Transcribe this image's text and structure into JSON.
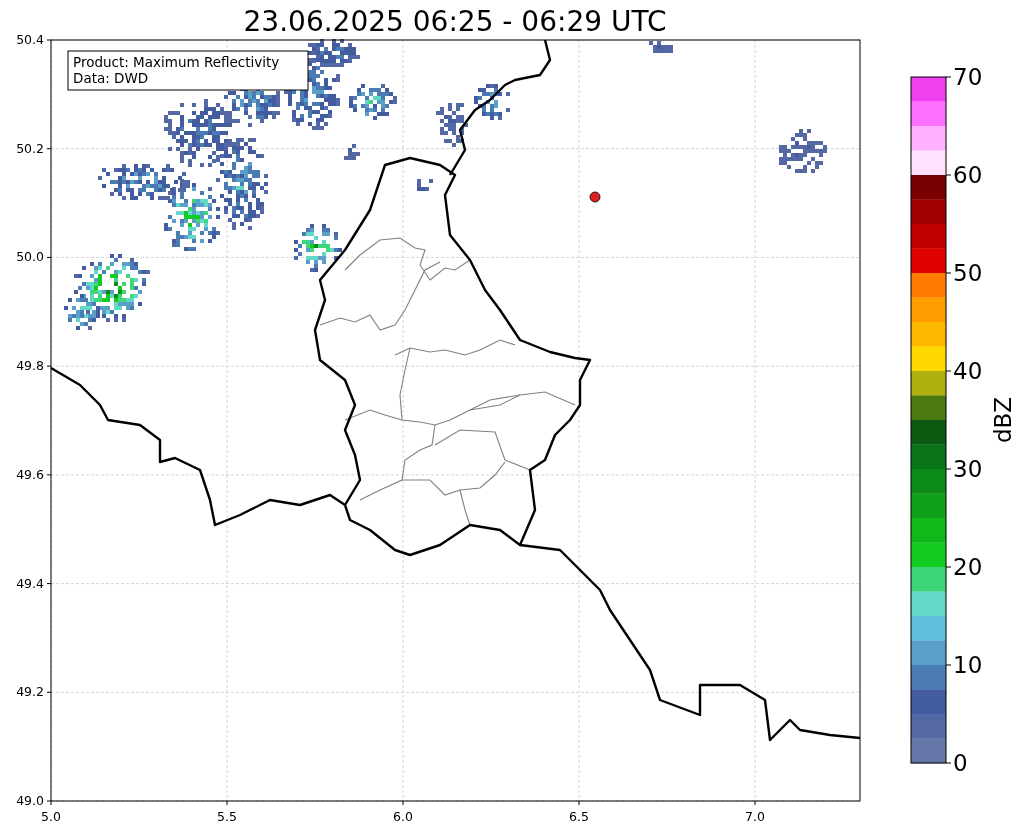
{
  "title": "23.06.2025 06:25 - 06:29 UTC",
  "map": {
    "annotation": [
      "Product: Maximum Reflectivity",
      "Data: DWD"
    ],
    "xticks": [
      "5.0",
      "5.5",
      "6.0",
      "6.5",
      "7.0"
    ],
    "yticks": [
      "50.4",
      "50.2",
      "50.0",
      "49.8",
      "49.6",
      "49.4",
      "49.2",
      "49.0"
    ]
  },
  "colorbar": {
    "label": "dBZ",
    "ticks": [
      "70",
      "60",
      "50",
      "40",
      "30",
      "20",
      "10",
      "0"
    ],
    "bands": [
      {
        "color": "#f040f0"
      },
      {
        "color": "#ff70ff"
      },
      {
        "color": "#ffb0ff"
      },
      {
        "color": "#ffe0ff"
      },
      {
        "color": "#780000"
      },
      {
        "color": "#a00000"
      },
      {
        "color": "#c00000"
      },
      {
        "color": "#e00000"
      },
      {
        "color": "#ff7c00"
      },
      {
        "color": "#ff9c00"
      },
      {
        "color": "#ffb800"
      },
      {
        "color": "#ffd800"
      },
      {
        "color": "#b0b010"
      },
      {
        "color": "#4a7a10"
      },
      {
        "color": "#0a5a12"
      },
      {
        "color": "#0a7418"
      },
      {
        "color": "#0c8a18"
      },
      {
        "color": "#10a01a"
      },
      {
        "color": "#10b81a"
      },
      {
        "color": "#12cc22"
      },
      {
        "color": "#3ed676"
      },
      {
        "color": "#62d8c8"
      },
      {
        "color": "#62c0dc"
      },
      {
        "color": "#5a9fca"
      },
      {
        "color": "#4a7bb2"
      },
      {
        "color": "#435ca0"
      },
      {
        "color": "#5468a5"
      },
      {
        "color": "#6677aa"
      }
    ]
  }
}
